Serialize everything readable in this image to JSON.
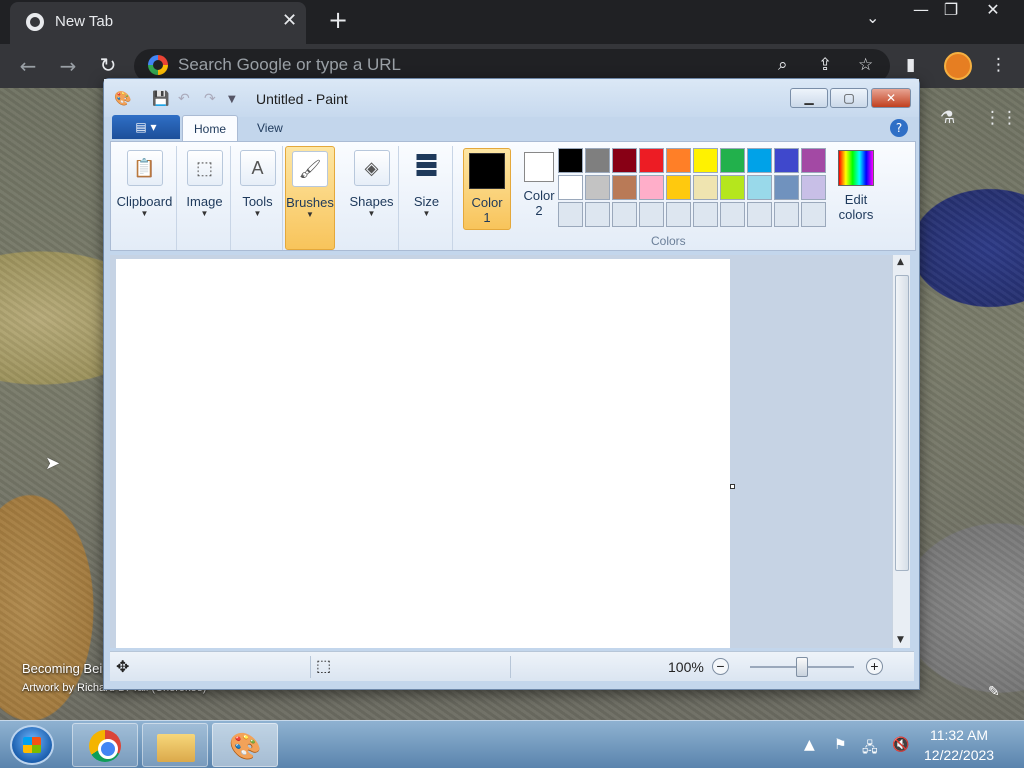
{
  "browser": {
    "tab_title": "New Tab",
    "omnibox_placeholder": "Search Google or type a URL"
  },
  "desktop": {
    "caption_title": "Becoming Bei",
    "caption_artist": "Artwork by Richard D. Tall (Cherokee)"
  },
  "paint": {
    "title": "Untitled - Paint",
    "tabs": [
      "Home",
      "View"
    ],
    "groups": {
      "clipboard": "Clipboard",
      "image": "Image",
      "tools": "Tools",
      "brushes": "Brushes",
      "shapes": "Shapes",
      "size": "Size",
      "color1_a": "Color",
      "color1_b": "1",
      "color2_a": "Color",
      "color2_b": "2",
      "edit_a": "Edit",
      "edit_b": "colors",
      "colors_label": "Colors"
    },
    "color1": "#000000",
    "color2": "#ffffff",
    "palette_row1": [
      "#000000",
      "#7f7f7f",
      "#880015",
      "#ed1c24",
      "#ff7f27",
      "#fff200",
      "#22b14c",
      "#00a2e8",
      "#3f48cc",
      "#a349a4"
    ],
    "palette_row2": [
      "#ffffff",
      "#c3c3c3",
      "#b97a57",
      "#ffaec9",
      "#ffc90e",
      "#efe4b0",
      "#b5e61d",
      "#99d9ea",
      "#7092be",
      "#c8bfe7"
    ],
    "zoom": "100%"
  },
  "taskbar": {
    "time": "11:32 AM",
    "date": "12/22/2023"
  }
}
